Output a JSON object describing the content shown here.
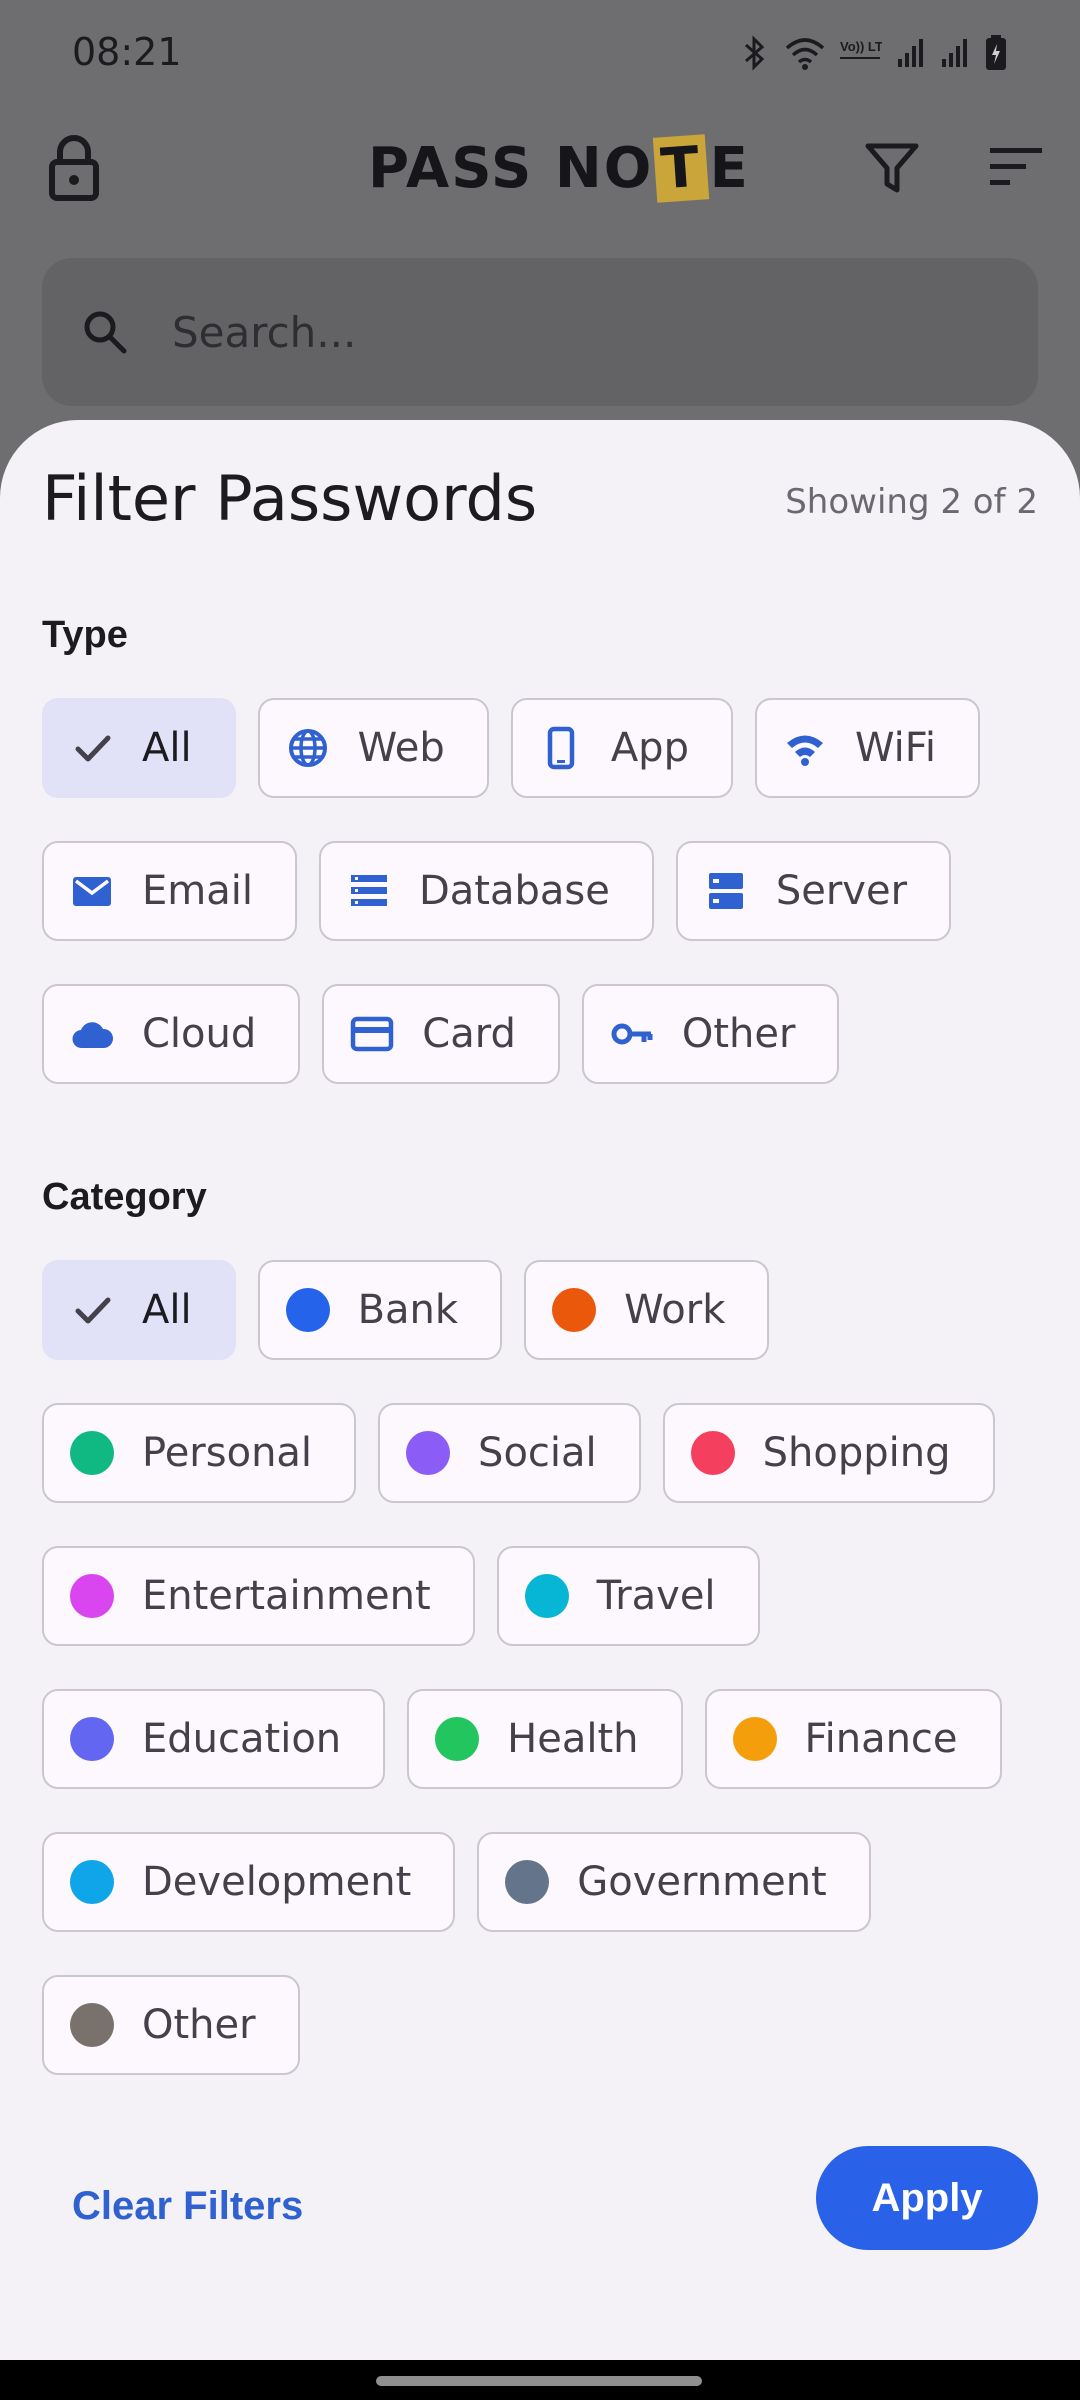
{
  "status_bar": {
    "time": "08:21",
    "icons": [
      "bluetooth-icon",
      "wifi-icon",
      "volte-icon",
      "signal-icon",
      "signal-icon",
      "battery-icon"
    ],
    "volte_label": "Vo)) LTE1"
  },
  "app_bar": {
    "logo_left": "PASS NO",
    "logo_t": "T",
    "logo_right": "E",
    "icons": [
      "lock-icon",
      "filter-icon",
      "sort-icon"
    ]
  },
  "search": {
    "placeholder": "Search..."
  },
  "filter_sheet": {
    "title": "Filter Passwords",
    "count": "Showing 2 of 2",
    "type_label": "Type",
    "type_chips": [
      {
        "label": "All",
        "icon": "check-icon",
        "selected": true
      },
      {
        "label": "Web",
        "icon": "globe-icon"
      },
      {
        "label": "App",
        "icon": "phone-icon"
      },
      {
        "label": "WiFi",
        "icon": "wifi-icon"
      },
      {
        "label": "Email",
        "icon": "mail-icon"
      },
      {
        "label": "Database",
        "icon": "database-icon"
      },
      {
        "label": "Server",
        "icon": "server-icon"
      },
      {
        "label": "Cloud",
        "icon": "cloud-icon"
      },
      {
        "label": "Card",
        "icon": "credit-card-icon"
      },
      {
        "label": "Other",
        "icon": "key-icon"
      }
    ],
    "category_label": "Category",
    "category_chips": [
      {
        "label": "All",
        "icon": "check-icon",
        "selected": true
      },
      {
        "label": "Bank",
        "color": "#2563eb"
      },
      {
        "label": "Work",
        "color": "#ea580c"
      },
      {
        "label": "Personal",
        "color": "#10b981"
      },
      {
        "label": "Social",
        "color": "#8b5cf6"
      },
      {
        "label": "Shopping",
        "color": "#f43f5e"
      },
      {
        "label": "Entertainment",
        "color": "#d946ef"
      },
      {
        "label": "Travel",
        "color": "#06b6d4"
      },
      {
        "label": "Education",
        "color": "#6366f1"
      },
      {
        "label": "Health",
        "color": "#22c55e"
      },
      {
        "label": "Finance",
        "color": "#f59e0b"
      },
      {
        "label": "Development",
        "color": "#0ea5e9"
      },
      {
        "label": "Government",
        "color": "#64748b"
      },
      {
        "label": "Other",
        "color": "#78716c"
      }
    ],
    "clear_label": "Clear Filters",
    "apply_label": "Apply"
  },
  "colors": {
    "accent": "#2962e8",
    "icon_blue": "#2f61d1",
    "selected_chip": "#e1e1f8",
    "sheet_bg": "#f5f2f7"
  }
}
